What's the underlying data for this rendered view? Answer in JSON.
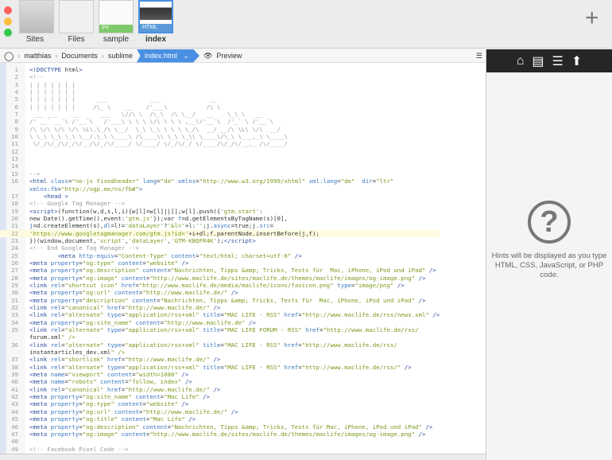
{
  "window": {
    "lights": [
      "#fc605c",
      "#fdbc40",
      "#34c84a"
    ]
  },
  "files": [
    {
      "label": "Sites",
      "badge": ""
    },
    {
      "label": "Files",
      "badge": ""
    },
    {
      "label": "sample",
      "badge": "PY",
      "badge_color": "#7fc96b"
    },
    {
      "label": "index",
      "badge": "HTML",
      "badge_color": "#5b9ad8"
    }
  ],
  "add_label": "+",
  "breadcrumb": {
    "items": [
      "matthias",
      "Documents",
      "sublime"
    ],
    "current": "index.html",
    "preview": "Preview"
  },
  "hints": {
    "text": "Hints will be displayed as you type HTML, CSS, JavaScript, or PHP code.",
    "icon": "?"
  },
  "code": [
    [
      "1",
      "<!DOCTYPE html>"
    ],
    [
      "2",
      "<!--"
    ],
    [
      "3",
      "| | | | | | |"
    ],
    [
      "4",
      "| | | | | | |"
    ],
    [
      "5",
      "| | | | | | |      ___            ___              __"
    ],
    [
      "6",
      "| | | | | | |     /\\_ \\    __    /'___\\           /\\ \\"
    ],
    [
      "7",
      " ___ ___    __      ___   \\//\\ \\  /\\_\\  /\\ \\__/   __    \\_\\ \\   __"
    ],
    [
      "8",
      "/' __` __`\\ /'__`\\   /'___\\ \\ \\ \\ \\/\\ \\ \\ \\ ,__\\/'__`\\  /'_` \\ /'__`\\"
    ],
    [
      "9",
      "/\\ \\/\\ \\/\\ \\/\\ \\L\\.\\_/\\ \\__/  \\_\\ \\_\\ \\ \\ \\ \\_/\\  __/ __/\\ \\L\\ \\/\\  __/"
    ],
    [
      "10",
      "\\ \\_\\ \\_\\ \\_\\ \\__/.\\_\\ \\____\\ /\\____\\\\ \\_\\ \\_\\\\ \\____\\/\\_\\ \\___,_\\ \\____\\"
    ],
    [
      "11",
      " \\/_/\\/_/\\/_/\\/__/\\/_/\\/____/ \\/____/ \\/_/\\/_/ \\/____/\\/_/\\/__,_ /\\/____/"
    ],
    [
      "12",
      ""
    ],
    [
      "13",
      ""
    ],
    [
      "14",
      ""
    ],
    [
      "15",
      "-->"
    ],
    [
      "16",
      "<html class=\"no-js fixedheader\" lang=\"de\" xmlns=\"http://www.w3.org/1999/xhtml\" xml:lang=\"de\"  dir=\"ltr\""
    ],
    [
      "",
      "xmlns:fb=\"http://ogp.me/ns/fb#\">"
    ],
    [
      "17",
      "    <head >"
    ],
    [
      "18",
      "<!-- Google Tag Manager -->"
    ],
    [
      "19",
      "<script>(function(w,d,s,l,i){w[l]=w[l]||[];w[l].push({'gtm.start':"
    ],
    [
      "20",
      "new Date().getTime(),event:'gtm.js'});var f=d.getElementsByTagName(s)[0],"
    ],
    [
      "21",
      "j=d.createElement(s),dl=l!='dataLayer'?'&l='+l:'';j.async=true;j.src="
    ],
    [
      "22",
      "'https://www.googletagmanager.com/gtm.js?id='+i+dl;f.parentNode.insertBefore(j,f);"
    ],
    [
      "23",
      "})(window,document,'script','dataLayer','GTM-KBQFR4K');</script>"
    ],
    [
      "24",
      "<!-- End Google Tag Manager -->"
    ],
    [
      "25",
      "        <meta http-equiv=\"Content-Type\" content=\"text/html; charset=utf-8\" />"
    ],
    [
      "26",
      "<meta property=\"og:type\" content=\"website\" />"
    ],
    [
      "27",
      "<meta property=\"og:description\" content=\"Nachrichten, Tipps &amp; Tricks, Tests für  Mac, iPhone, iPod und iPad\" />"
    ],
    [
      "28",
      "<meta property=\"og:image\" content=\"http://www.maclife.de/sites/maclife.de/themes/maclife/images/og-image.png\" />"
    ],
    [
      "29",
      "<link rel=\"shortcut icon\" href=\"http://www.maclife.de/media/maclife/icons/favicon.png\" type=\"image/png\" />"
    ],
    [
      "30",
      "<meta property=\"og:url\" content=\"http://www.maclife.de/\" />"
    ],
    [
      "31",
      "<meta property=\"description\" content=\"Nachrichten, Tipps &amp; Tricks, Tests für  Mac, iPhone, iPod und iPad\" />"
    ],
    [
      "32",
      "<link rel=\"canonical\" href=\"http://www.maclife.de/\" />"
    ],
    [
      "33",
      "<link rel=\"alternate\" type=\"application/rss+xml\" title=\"MAC LIFE - RSS\" href=\"http://www.maclife.de/rss/news.xml\" />"
    ],
    [
      "34",
      "<meta property=\"og:site_name\" content=\"http://www.maclife.de\" />"
    ],
    [
      "35",
      "<link rel=\"alternate\" type=\"application/rss+xml\" title=\"MAC LIFE FORUM - RSS\" href=\"http://www.maclife.de/rss/"
    ],
    [
      "",
      "forum.xml\" />"
    ],
    [
      "36",
      "<link rel=\"alternate\" type=\"application/rss+xml\" title=\"MAC LIFE - RSS\" href=\"http://www.maclife.de/rss/"
    ],
    [
      "",
      "instantarticles_dev.xml\" />"
    ],
    [
      "37",
      "<link rel=\"shortlink\" href=\"http://www.maclife.de/\" />"
    ],
    [
      "38",
      "<link rel=\"alternate\" type=\"application/rss+xml\" title=\"MAC LIFE - RSS\" href=\"http://www.maclife.de/rss/\" />"
    ],
    [
      "39",
      "<meta name=\"viewport\" content=\"width=1080\" />"
    ],
    [
      "40",
      "<meta name=\"robots\" content=\"follow, index\" />"
    ],
    [
      "41",
      "<link rel=\"canonical\" href=\"http://www.maclife.de/\" />"
    ],
    [
      "42",
      "<meta property=\"og:site_name\" content=\"Mac Life\" />"
    ],
    [
      "43",
      "<meta property=\"og:type\" content=\"website\" />"
    ],
    [
      "44",
      "<meta property=\"og:url\" content=\"http://www.maclife.de/\" />"
    ],
    [
      "45",
      "<meta property=\"og:title\" content=\"Mac Life\" />"
    ],
    [
      "46",
      "<meta property=\"og:description\" content=\"Nachrichten, Tipps &amp; Tricks, Tests für Mac, iPhone, iPod und iPad\" />"
    ],
    [
      "47",
      "<meta property=\"og:image\" content=\"http://www.maclife.de/sites/maclife.de/themes/maclife/images/og-image.png\" />"
    ],
    [
      "48",
      ""
    ],
    [
      "49",
      "<!-- Facebook Pixel Code -->"
    ]
  ],
  "active_line": "22"
}
